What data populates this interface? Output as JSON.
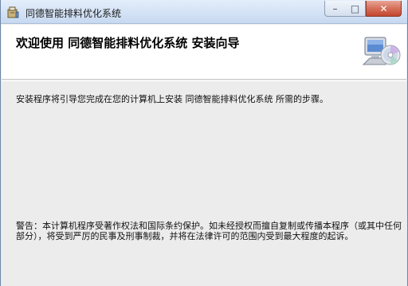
{
  "window": {
    "title": "同德智能排料优化系统",
    "controls": {
      "minimize_glyph": "–",
      "maximize_glyph": "□",
      "close_glyph": "✕"
    },
    "icons": {
      "app": "installer-box-icon",
      "banner": "computer-cd-icon"
    }
  },
  "banner": {
    "title": "欢迎使用 同德智能排料优化系统 安装向导"
  },
  "content": {
    "intro": "安装程序将引导您完成在您的计算机上安装 同德智能排料优化系统 所需的步骤。",
    "warning": "警告：本计算机程序受著作权法和国际条约保护。如未经授权而擅自复制或传播本程序（或其中任何部分），将受到严厉的民事及刑事制裁，并将在法律许可的范围内受到最大程度的起诉。"
  },
  "colors": {
    "close_button": "#c4472f",
    "titlebar": "#d6e4f6",
    "content_bg": "#ececec"
  }
}
